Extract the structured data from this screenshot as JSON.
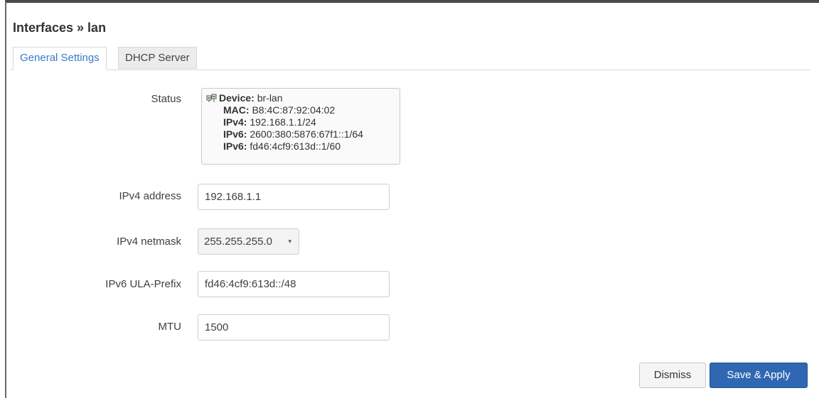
{
  "title": "Interfaces » lan",
  "tabs": [
    {
      "label": "General Settings",
      "active": true
    },
    {
      "label": "DHCP Server",
      "active": false
    }
  ],
  "status": {
    "label": "Status",
    "icon": "network-ports-icon",
    "device_label": "Device:",
    "device_value": "br-lan",
    "mac_label": "MAC:",
    "mac_value": "B8:4C:87:92:04:02",
    "ipv4_label": "IPv4:",
    "ipv4_value": "192.168.1.1/24",
    "ipv6a_label": "IPv6:",
    "ipv6a_value": "2600:380:5876:67f1::1/64",
    "ipv6b_label": "IPv6:",
    "ipv6b_value": "fd46:4cf9:613d::1/60"
  },
  "fields": {
    "ipv4_address": {
      "label": "IPv4 address",
      "value": "192.168.1.1"
    },
    "ipv4_netmask": {
      "label": "IPv4 netmask",
      "value": "255.255.255.0"
    },
    "ipv6_ula": {
      "label": "IPv6 ULA-Prefix",
      "value": "fd46:4cf9:613d::/48"
    },
    "mtu": {
      "label": "MTU",
      "value": "1500"
    }
  },
  "buttons": {
    "dismiss": "Dismiss",
    "apply": "Save & Apply"
  },
  "colors": {
    "accent": "#2f67b2",
    "active_tab_text": "#3a7bc8"
  }
}
